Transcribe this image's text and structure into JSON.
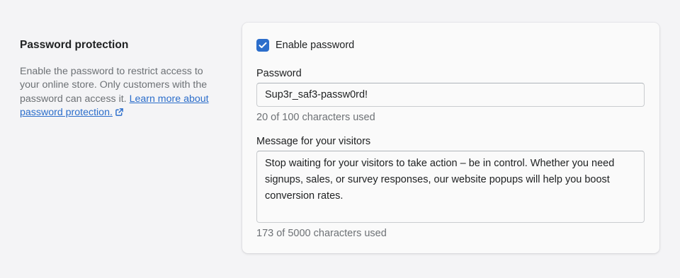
{
  "section": {
    "title": "Password protection",
    "description": "Enable the password to restrict access to your online store. Only customers with the password can access it.",
    "link_text": "Learn more about password protection."
  },
  "enable_password": {
    "label": "Enable password",
    "checked": true
  },
  "password": {
    "label": "Password",
    "value": "Sup3r_saf3-passw0rd!",
    "help": "20 of 100 characters used"
  },
  "message": {
    "label": "Message for your visitors",
    "value": "Stop waiting for your visitors to take action – be in control. Whether you need signups, sales, or survey responses, our website popups will help you boost conversion rates.",
    "help": "173 of 5000 characters used"
  },
  "colors": {
    "accent": "#2c6ecb",
    "background": "#f4f4f6",
    "card": "#fafafa",
    "subdued_text": "#6d7175"
  },
  "icons": {
    "checkbox": "checkmark-icon",
    "external_link": "external-link-icon"
  }
}
